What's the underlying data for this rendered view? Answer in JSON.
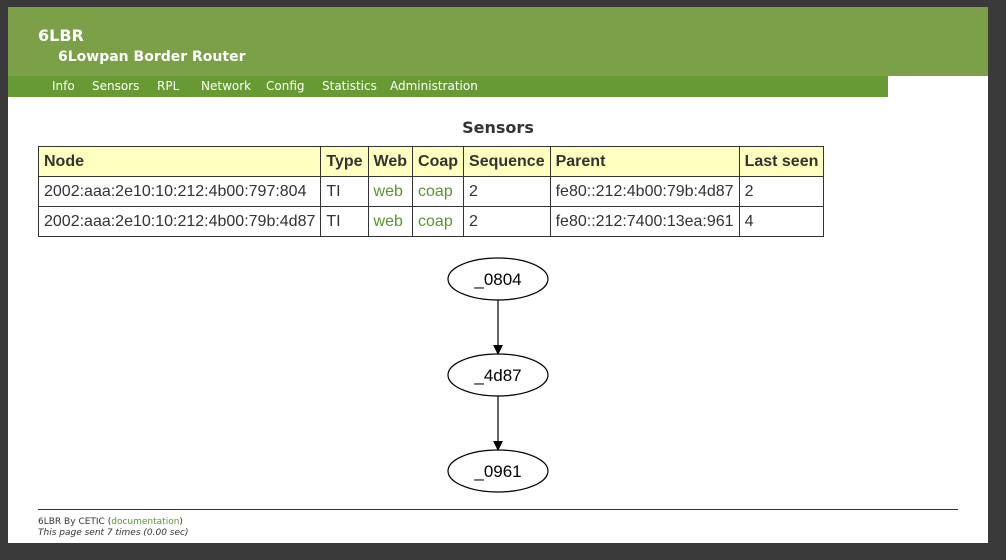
{
  "header": {
    "brand": "6LBR",
    "subtitle": "6Lowpan Border Router"
  },
  "nav": [
    "Info",
    "Sensors",
    "RPL",
    "Network",
    "Config",
    "Statistics",
    "Administration"
  ],
  "section_title": "Sensors",
  "table": {
    "headers": [
      "Node",
      "Type",
      "Web",
      "Coap",
      "Sequence",
      "Parent",
      "Last seen"
    ],
    "rows": [
      {
        "node": "2002:aaa:2e10:10:212:4b00:797:804",
        "type": "TI",
        "web": "web",
        "coap": "coap",
        "sequence": "2",
        "parent": "fe80::212:4b00:79b:4d87",
        "last_seen": "2"
      },
      {
        "node": "2002:aaa:2e10:10:212:4b00:79b:4d87",
        "type": "TI",
        "web": "web",
        "coap": "coap",
        "sequence": "2",
        "parent": "fe80::212:7400:13ea:961",
        "last_seen": "4"
      }
    ]
  },
  "graph": {
    "nodes": [
      "_0804",
      "_4d87",
      "_0961"
    ]
  },
  "footer": {
    "brand": "6LBR",
    "by": "By",
    "org": "CETIC",
    "paren_open": "(",
    "doc_link": "documentation",
    "paren_close": ")",
    "sent": "This page sent 7 times (0.00 sec)"
  }
}
